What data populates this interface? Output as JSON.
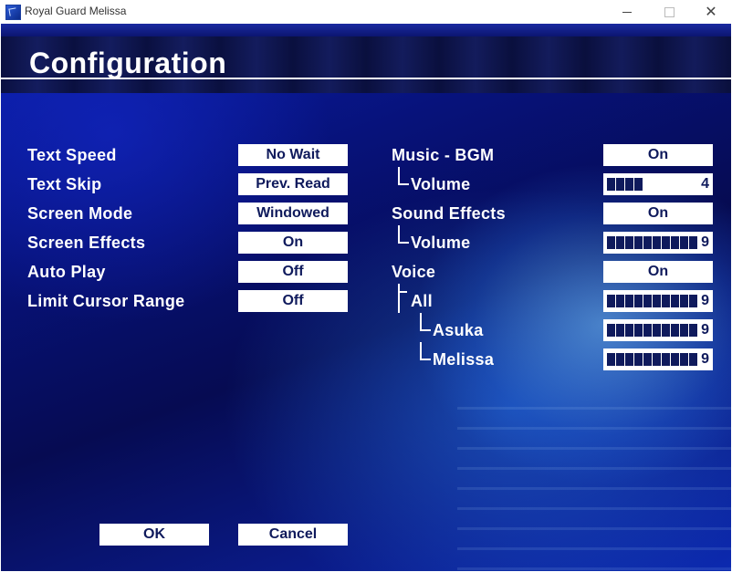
{
  "window": {
    "title": "Royal Guard Melissa",
    "close_glyph": "✕"
  },
  "page": {
    "title": "Configuration"
  },
  "left_settings": [
    {
      "label": "Text Speed",
      "value": "No Wait"
    },
    {
      "label": "Text Skip",
      "value": "Prev. Read"
    },
    {
      "label": "Screen Mode",
      "value": "Windowed"
    },
    {
      "label": "Screen Effects",
      "value": "On"
    },
    {
      "label": "Auto Play",
      "value": "Off"
    },
    {
      "label": "Limit Cursor Range",
      "value": "Off"
    }
  ],
  "audio": {
    "music": {
      "label": "Music - BGM",
      "value": "On",
      "volume_label": "Volume",
      "volume": "4"
    },
    "sound": {
      "label": "Sound Effects",
      "value": "On",
      "volume_label": "Volume",
      "volume": "9"
    },
    "voice": {
      "label": "Voice",
      "value": "On",
      "all_label": "All",
      "all_volume": "9",
      "asuka_label": "Asuka",
      "asuka_volume": "9",
      "melissa_label": "Melissa",
      "melissa_volume": "9"
    }
  },
  "actions": {
    "ok": "OK",
    "cancel": "Cancel"
  },
  "colors": {
    "accent_text": "#0f1a5c",
    "panel": "#ffffff"
  }
}
